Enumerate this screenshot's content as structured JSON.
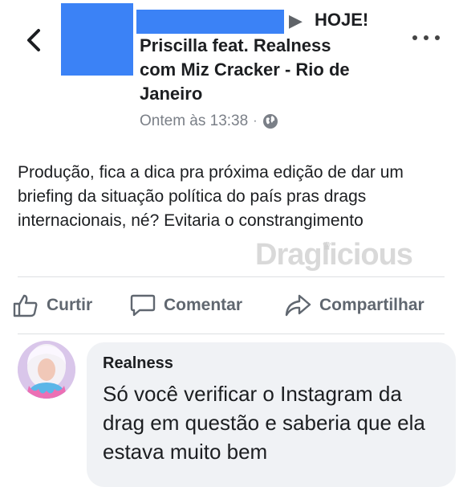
{
  "header": {
    "back_icon": "chevron-left-icon",
    "more_icon": "more-horizontal-icon",
    "arrow": "▶",
    "event_lines": [
      "HOJE!",
      "Priscilla feat. Realness",
      "com Miz Cracker - Rio de",
      "Janeiro"
    ],
    "timestamp": "Ontem às 13:38",
    "separator": "·",
    "privacy_icon": "globe-icon",
    "redaction_color": "#3b82f6"
  },
  "post": {
    "text": "Produção, fica a dica pra próxima edição de dar um briefing da situação política do país pras drags internacionais, né? Evitaria o constrangimento"
  },
  "watermark": {
    "text": "Draglicious"
  },
  "actions": {
    "like_label": "Curtir",
    "comment_label": "Comentar",
    "share_label": "Compartilhar"
  },
  "comment": {
    "author": "Realness",
    "text": "Só você verificar o Instagram da drag em questão e saberia que ela estava muito bem"
  }
}
